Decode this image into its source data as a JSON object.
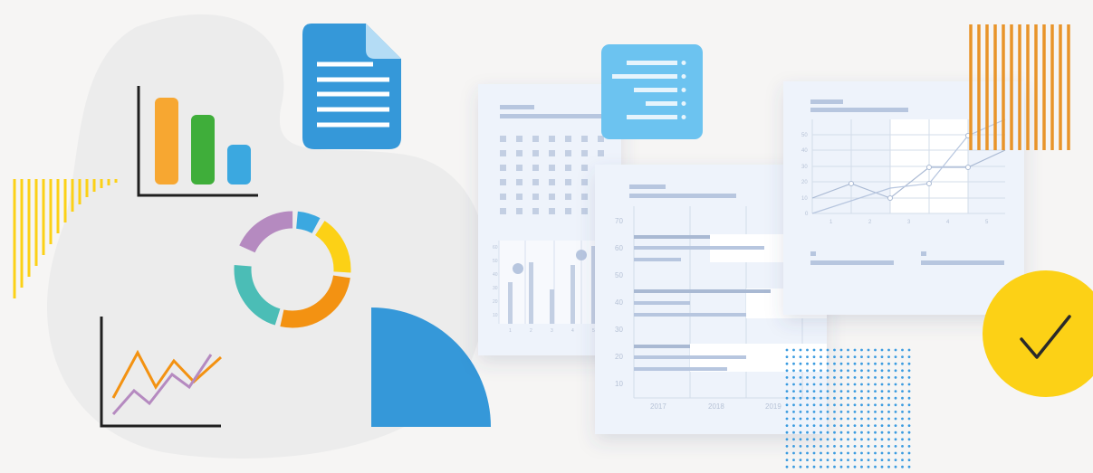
{
  "palette": {
    "blob": "#ececec",
    "orange": "#f7a731",
    "green": "#3fae3a",
    "blue": "#3ba8e0",
    "doc_blue": "#3598d9",
    "light_blue": "#6cc3f0",
    "purple": "#b58ac0",
    "teal": "#4bbdb6",
    "yellow": "#fcd116",
    "donut_orange": "#f39212",
    "axis_black": "#1f1f1f",
    "stripe_orange": "#e8942a",
    "stripe_yellow": "#fcd116",
    "dots_blue": "#3a9be0",
    "card_bg": "#eef3fb",
    "card_line": "#b7c6df"
  },
  "icons": {
    "bar_chart": "bar-chart-icon",
    "document": "document-icon",
    "donut": "donut-chart-icon",
    "line_chart": "line-chart-icon",
    "quarter_pie": "quarter-pie-icon",
    "list": "list-icon",
    "check": "checkmark-icon"
  },
  "middle_card": {
    "y_ticks": [
      "70",
      "60",
      "50",
      "40",
      "30",
      "20",
      "10"
    ],
    "x_ticks": [
      "2017",
      "2018",
      "2019"
    ]
  },
  "right_card": {
    "y_ticks": [
      "50",
      "40",
      "30",
      "20",
      "10",
      "0"
    ],
    "x_ticks": [
      "1",
      "2",
      "3",
      "4",
      "5"
    ]
  },
  "left_card": {
    "y_ticks": [
      "60",
      "50",
      "40",
      "30",
      "20",
      "10"
    ],
    "x_ticks": [
      "1",
      "2",
      "3",
      "4",
      "5"
    ]
  }
}
